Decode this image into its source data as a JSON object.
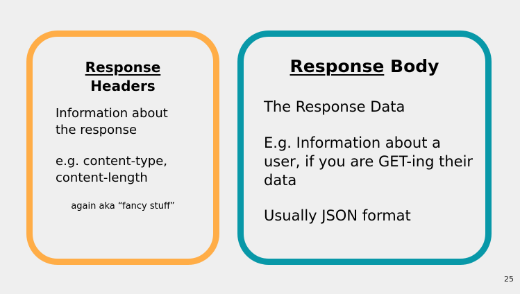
{
  "slide": {
    "number": "25"
  },
  "left_card": {
    "title_line1": "Response",
    "title_line2": "Headers",
    "text1": "Information about\nthe response",
    "text2": "e.g. content-type,\ncontent-length",
    "note": "again aka “fancy stuff”",
    "border_color": "#ffad47"
  },
  "right_card": {
    "title_underlined": "Response",
    "title_rest": "Body",
    "text1": "The Response Data",
    "text2": "E.g. Information about a\nuser, if you are GET-ing their\ndata",
    "text3": "Usually JSON format",
    "border_color": "#0898a8"
  }
}
